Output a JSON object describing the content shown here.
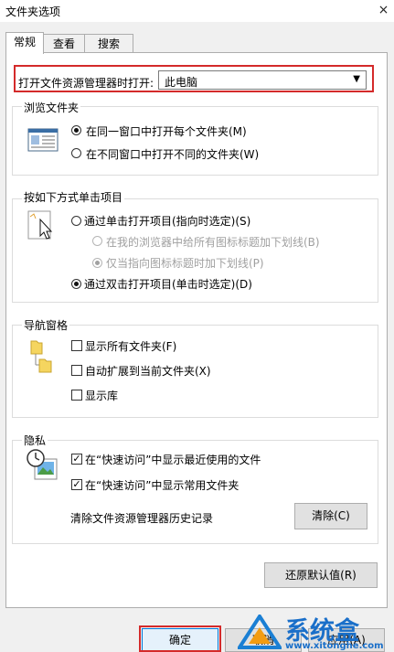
{
  "window": {
    "title": "文件夹选项",
    "close_glyph": "×"
  },
  "tabs": [
    {
      "label": "常规"
    },
    {
      "label": "查看"
    },
    {
      "label": "搜索"
    }
  ],
  "open_explorer": {
    "label": "打开文件资源管理器时打开:",
    "value": "此电脑"
  },
  "browse_folders": {
    "title": "浏览文件夹",
    "options": [
      "在同一窗口中打开每个文件夹(M)",
      "在不同窗口中打开不同的文件夹(W)"
    ]
  },
  "click_items": {
    "title": "按如下方式单击项目",
    "options": [
      "通过单击打开项目(指向时选定)(S)",
      "在我的浏览器中给所有图标标题加下划线(B)",
      "仅当指向图标标题时加下划线(P)",
      "通过双击打开项目(单击时选定)(D)"
    ]
  },
  "nav_pane": {
    "title": "导航窗格",
    "options": [
      "显示所有文件夹(F)",
      "自动扩展到当前文件夹(X)",
      "显示库"
    ]
  },
  "privacy": {
    "title": "隐私",
    "options": [
      "在“快速访问”中显示最近使用的文件",
      "在“快速访问”中显示常用文件夹"
    ],
    "clear_history_label": "清除文件资源管理器历史记录",
    "clear_button": "清除(C)"
  },
  "restore_button": "还原默认值(R)",
  "footer": {
    "ok": "确定",
    "cancel": "取消",
    "apply": "应用(A)"
  },
  "watermark": {
    "brand": "系统盒",
    "url": "www.xitonghe.com"
  },
  "colors": {
    "highlight_border": "#d42a2a",
    "folder_yellow": "#f5d55f"
  }
}
